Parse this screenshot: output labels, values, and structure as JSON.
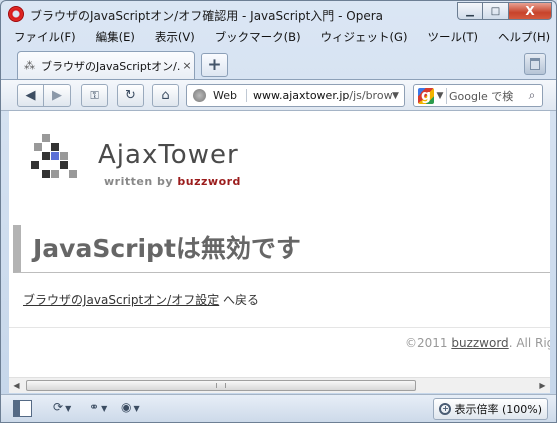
{
  "window": {
    "title": "ブラウザのJavaScriptオン/オフ確認用 - JavaScript入門 - Opera",
    "minimize": "▁",
    "maximize": "□",
    "close": "X"
  },
  "menu": [
    "ファイル(F)",
    "編集(E)",
    "表示(V)",
    "ブックマーク(B)",
    "ウィジェット(G)",
    "ツール(T)",
    "ヘルプ(H)"
  ],
  "tab": {
    "label": "ブラウザのJavaScriptオン/...",
    "close": "×",
    "new_tab": "+"
  },
  "toolbar": {
    "back": "◀",
    "forward": "▶",
    "key": "⚿",
    "reload": "↻",
    "home": "⌂",
    "address_label": "Web",
    "url_host": "www.ajaxtower.jp",
    "url_path": "/js/brows",
    "search_engine": "g",
    "search_placeholder": "Google で検",
    "search_go": "⌕"
  },
  "page": {
    "logo_text": "AjaxTower",
    "logo_written": "written by",
    "logo_brand": "buzzword",
    "heading": "JavaScriptは無効です",
    "back_link": "ブラウザのJavaScriptオン/オフ設定",
    "back_suffix": " へ戻る",
    "footer_prefix": "©2011 ",
    "footer_link": "buzzword",
    "footer_suffix": ". All Rights"
  },
  "statusbar": {
    "zoom_label": "表示倍率 (100%)"
  },
  "colors": {
    "logo_dark": "#333333",
    "logo_gray": "#999999",
    "logo_blue": "#5b6fd6",
    "brand_red": "#9b1c1c"
  }
}
